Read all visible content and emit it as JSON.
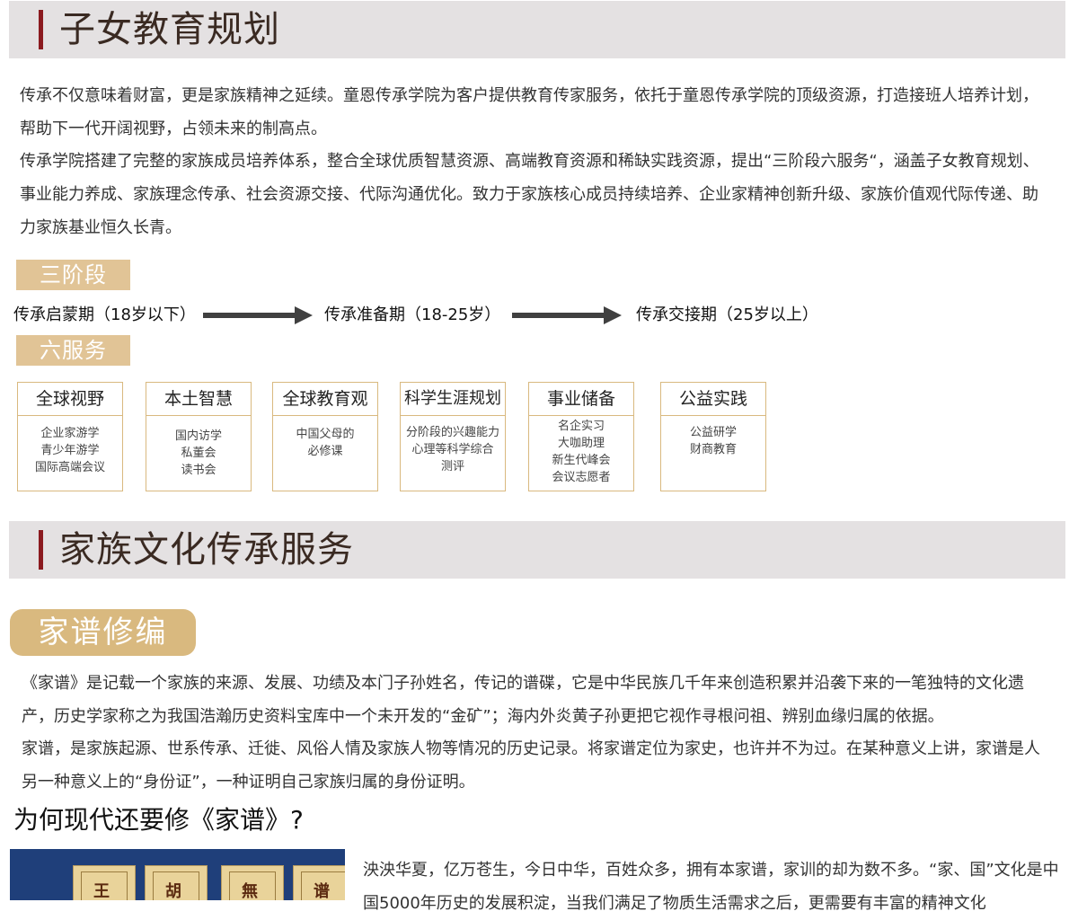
{
  "section1": {
    "title": "子女教育规划",
    "para1": "传承不仅意味着财富，更是家族精神之延续。童恩传承学院为客户提供教育传家服务，依托于童恩传承学院的顶级资源，打造接班人培养计划，帮助下一代开阔视野，占领未来的制高点。",
    "para2": "传承学院搭建了完整的家族成员培养体系，整合全球优质智慧资源、高端教育资源和稀缺实践资源，提出“三阶段六服务“，涵盖子女教育规划、事业能力养成、家族理念传承、社会资源交接、代际沟通优化。致力于家族核心成员持续培养、企业家精神创新升级、家族价值观代际传递、助力家族基业恒久长青。"
  },
  "stages": {
    "tag": "三阶段",
    "items": [
      "传承启蒙期（18岁以下）",
      "传承准备期（18-25岁）",
      "传承交接期（25岁以上）"
    ]
  },
  "services": {
    "tag": "六服务",
    "cards": [
      {
        "title": "全球视野",
        "lines": [
          "企业家游学",
          "青少年游学",
          "国际高端会议"
        ]
      },
      {
        "title": "本土智慧",
        "lines": [
          "国内访学",
          "私董会",
          "读书会"
        ]
      },
      {
        "title": "全球教育观",
        "lines": [
          "中国父母的",
          "必修课"
        ]
      },
      {
        "title": "科学生涯规划",
        "lines": [
          "分阶段的兴趣能力",
          "心理等科学综合",
          "测评"
        ]
      },
      {
        "title": "事业储备",
        "lines": [
          "名企实习",
          "大咖助理",
          "新生代峰会",
          "会议志愿者"
        ]
      },
      {
        "title": "公益实践",
        "lines": [
          "公益研学",
          "财商教育"
        ]
      }
    ]
  },
  "section2": {
    "title": "家族文化传承服务",
    "pill": "家谱修编",
    "para1": "《家谱》是记载一个家族的来源、发展、功绩及本门子孙姓名，传记的谱碟，它是中华民族几千年来创造积累并沿袭下来的一笔独特的文化遗产，历史学家称之为我国浩瀚历史资料宝库中一个未开发的“金矿”；海内外炎黄子孙更把它视作寻根问祖、辨别血缘归属的依据。",
    "para2": "家谱，是家族起源、世系传承、迁徙、风俗人情及家族人物等情况的历史记录。将家谱定位为家史，也许并不为过。在某种意义上讲，家谱是人另一种意义上的“身份证”，一种证明自己家族归属的身份证明。",
    "subheading": "为何现代还要修《家谱》?",
    "para3": "泱泱华夏，亿万苍生，今日中华，百姓众多，拥有本家谱，家训的却为数不多。“家、国”文化是中国5000年历史的发展积淀，当我们满足了物质生活需求之后，更需要有丰富的精神文化"
  },
  "colors": {
    "accent": "#8b1a1f",
    "gold": "#d9b97f",
    "band": "#e4e1e2"
  }
}
